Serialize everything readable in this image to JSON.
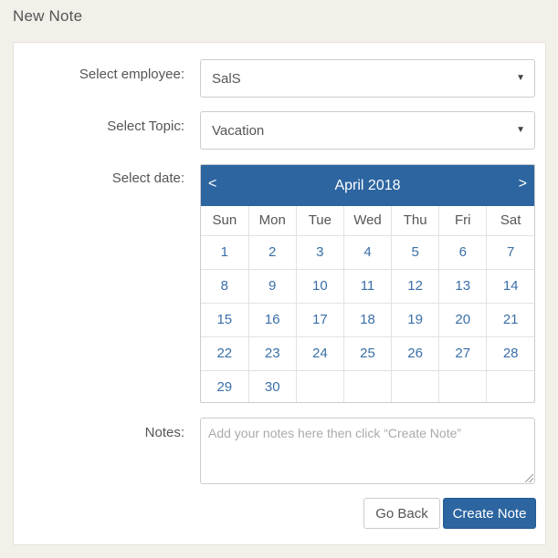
{
  "page": {
    "title": "New Note"
  },
  "form": {
    "employee_label": "Select employee:",
    "employee_value": "SalS",
    "topic_label": "Select Topic:",
    "topic_value": "Vacation",
    "date_label": "Select date:",
    "notes_label": "Notes:",
    "notes_placeholder": "Add your notes here then click “Create Note”"
  },
  "calendar": {
    "month_label": "April 2018",
    "prev": "<",
    "next": ">",
    "weekdays": [
      "Sun",
      "Mon",
      "Tue",
      "Wed",
      "Thu",
      "Fri",
      "Sat"
    ],
    "weeks": [
      [
        "1",
        "2",
        "3",
        "4",
        "5",
        "6",
        "7"
      ],
      [
        "8",
        "9",
        "10",
        "11",
        "12",
        "13",
        "14"
      ],
      [
        "15",
        "16",
        "17",
        "18",
        "19",
        "20",
        "21"
      ],
      [
        "22",
        "23",
        "24",
        "25",
        "26",
        "27",
        "28"
      ],
      [
        "29",
        "30",
        "",
        "",
        "",
        "",
        ""
      ]
    ]
  },
  "buttons": {
    "back": "Go Back",
    "create": "Create Note"
  },
  "colors": {
    "accent": "#2c65a0",
    "link": "#3a6fa8",
    "background": "#f3f0ea"
  },
  "icons": {
    "select_caret": "caret-down-icon",
    "prev": "chevron-left-icon",
    "next": "chevron-right-icon"
  }
}
